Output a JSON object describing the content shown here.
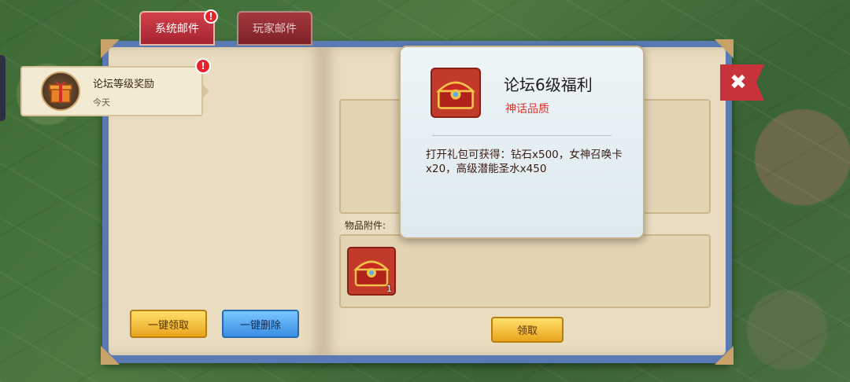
{
  "tabs": {
    "system_mail": "系统邮件",
    "player_mail": "玩家邮件",
    "system_badge": "!"
  },
  "mail_list": [
    {
      "title": "论坛等级奖励",
      "date": "今天",
      "badge": "!"
    }
  ],
  "left_buttons": {
    "claim_all": "一键领取",
    "delete_all": "一键删除"
  },
  "attachments": {
    "label": "物品附件:",
    "items": [
      {
        "icon": "treasure-chest-icon",
        "count": "1"
      }
    ]
  },
  "claim_button": "领取",
  "popup": {
    "title": "论坛6级福利",
    "quality": "神话品质",
    "description": "打开礼包可获得：钻石x500，女神召唤卡x20，高级潜能圣水x450",
    "ghost_char": "论"
  },
  "close_glyph": "✖",
  "colors": {
    "tab_red": "#c83640",
    "quality_red": "#e0352c",
    "button_yellow": "#f3c443",
    "button_blue": "#4a9de8",
    "parchment": "#e9dcc0"
  }
}
